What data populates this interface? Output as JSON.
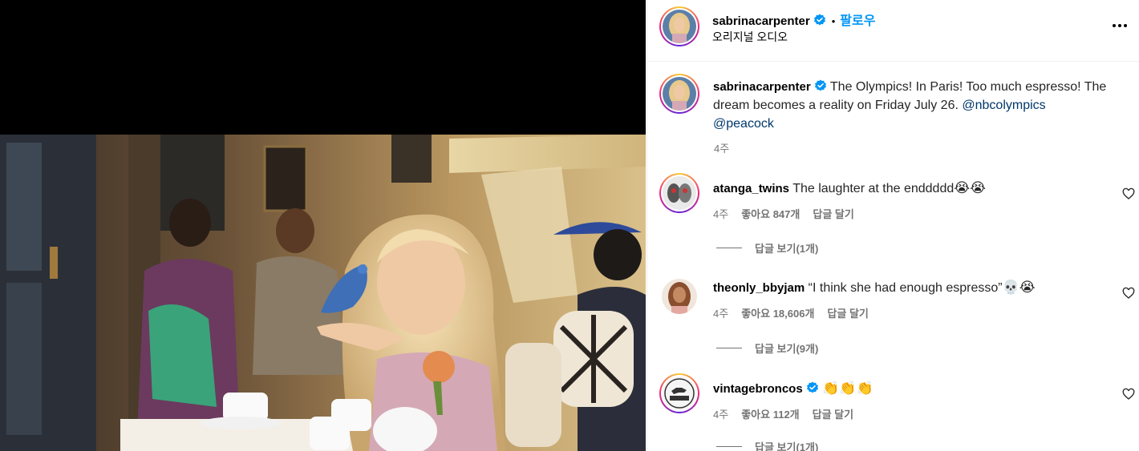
{
  "header": {
    "username": "sabrinacarpenter",
    "separator": "•",
    "follow_label": "팔로우",
    "audio_label": "오리지널 오디오"
  },
  "caption": {
    "username": "sabrinacarpenter",
    "text": "The Olympics! In Paris! Too much espresso! The dream becomes a reality on Friday July 26.",
    "mention1": "@nbcolympics",
    "mention2": "@peacock",
    "time": "4주"
  },
  "comments": [
    {
      "username": "atanga_twins",
      "text": "The laughter at the enddddd",
      "emojis": "😭😭",
      "time": "4주",
      "likes": "좋아요 847개",
      "reply_label": "답글 달기",
      "view_replies": "답글 보기(1개)"
    },
    {
      "username": "theonly_bbyjam",
      "text": "“I think she had enough espresso”",
      "emojis": "💀😭",
      "time": "4주",
      "likes": "좋아요 18,606개",
      "reply_label": "답글 달기",
      "view_replies": "답글 보기(9개)"
    },
    {
      "username": "vintagebroncos",
      "text": "",
      "emojis": "👏👏👏",
      "time": "4주",
      "likes": "좋아요 112개",
      "reply_label": "답글 달기",
      "view_replies": "답글 보기(1개)"
    }
  ],
  "colors": {
    "accent": "#0095f6",
    "mention": "#00376b",
    "meta": "#737373",
    "verified": "#0095f6"
  },
  "icons": {
    "verified": "verified-badge-icon",
    "more": "more-options-icon",
    "like": "heart-icon"
  }
}
